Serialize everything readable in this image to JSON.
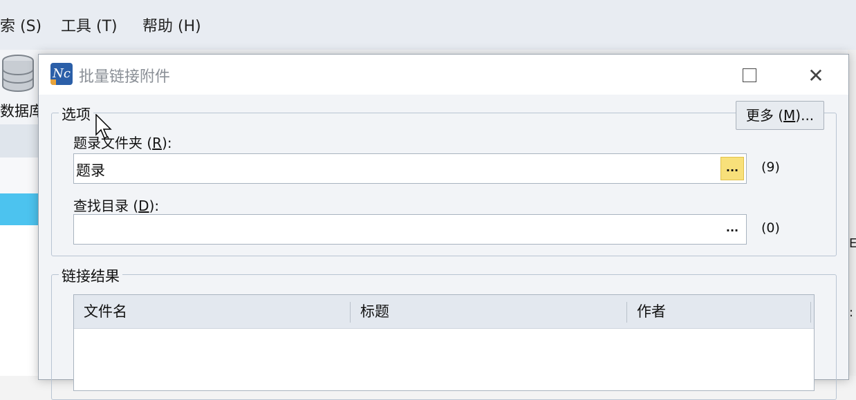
{
  "background_app": {
    "menu": [
      {
        "label": "索 (S)"
      },
      {
        "label": "工具 (T)"
      },
      {
        "label": "帮助 (H)"
      }
    ],
    "toolbar_label": "数据库",
    "right_edge_glyphs": [
      "E",
      ":"
    ]
  },
  "dialog": {
    "title": "批量链接附件",
    "icon_text": "Nc",
    "options_group": {
      "legend": "选项",
      "more_button": {
        "text": "更多 (",
        "mnemonic": "M",
        "suffix": ")..."
      },
      "record_folder": {
        "label": "题录文件夹 (",
        "mnemonic": "R",
        "label_suffix": "):",
        "value": "题录",
        "browse": "...",
        "count": "(9)"
      },
      "search_dir": {
        "label": "查找目录 (",
        "mnemonic": "D",
        "label_suffix": "):",
        "value": "",
        "browse": "...",
        "count": "(0)"
      }
    },
    "results_group": {
      "legend": "链接结果",
      "columns": [
        "文件名",
        "标题",
        "作者"
      ]
    }
  }
}
